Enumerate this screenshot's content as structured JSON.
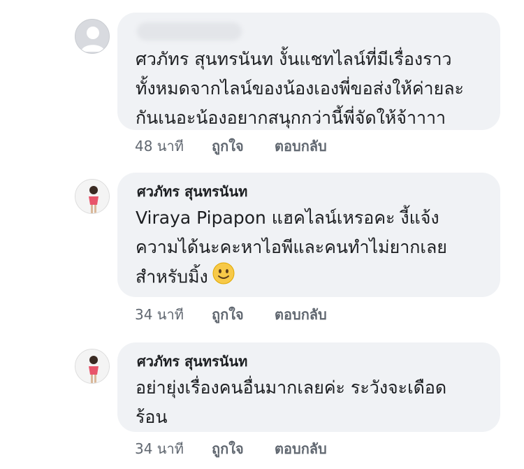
{
  "comments": [
    {
      "author": "",
      "author_hidden": true,
      "lines": [
        "ศวภัทร สุนทรนันท งั้นแชทไลน์ที่มีเรื่องราว",
        "ทั้งหมดจากไลน์ของน้องเองพี่ขอส่งให้ค่ายละ",
        "กันเนอะน้องอยากสนุกกว่านี้พี่จัดให้จ้าาาา"
      ],
      "time": "48 นาที",
      "like": "ถูกใจ",
      "reply": "ตอบกลับ"
    },
    {
      "author": "ศวภัทร สุนทรนันท",
      "lines": [
        "Viraya Pipapon แฮคไลน์เหรอคะ งี้แจ้ง",
        "ความได้นะคะหาไอพีและคนทำไม่ยากเลย",
        "สำหรับมิ้ง"
      ],
      "emoji": "slightly-smiling-face-icon",
      "time": "34 นาที",
      "like": "ถูกใจ",
      "reply": "ตอบกลับ"
    },
    {
      "author": "ศวภัทร สุนทรนันท",
      "lines": [
        "อย่ายุ่งเรื่องคนอื่นมากเลยค่ะ ระวังจะเดือด",
        "ร้อน"
      ],
      "time": "34 นาที",
      "like": "ถูกใจ",
      "reply": "ตอบกลับ"
    }
  ],
  "colors": {
    "bubble": "#f0f2f5",
    "text": "#1c1e21",
    "meta": "#606770",
    "emoji": "#f7c948"
  }
}
